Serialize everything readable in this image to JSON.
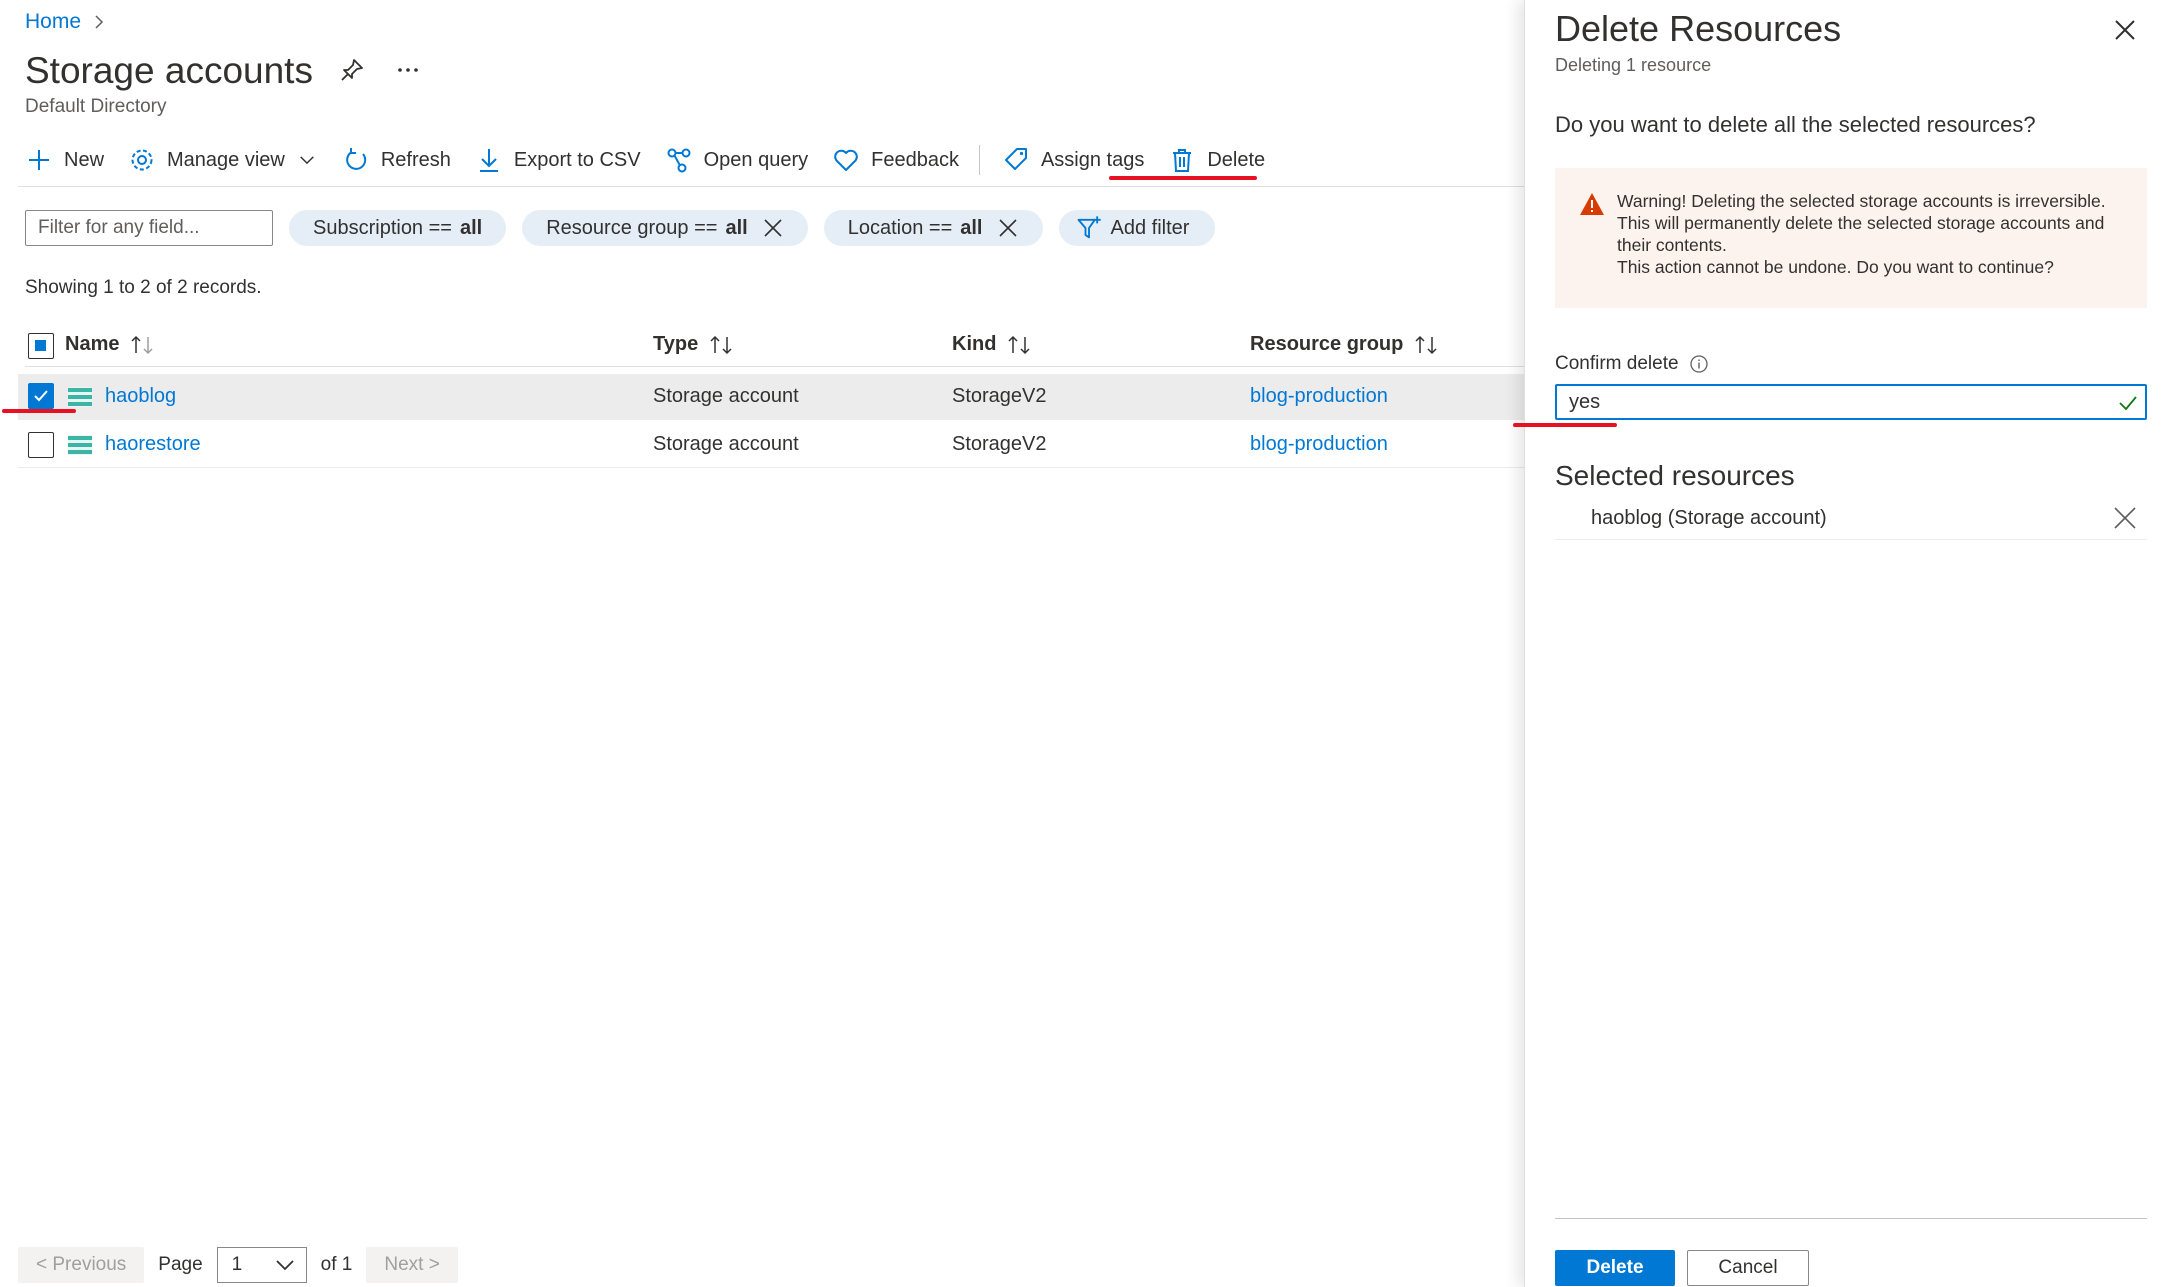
{
  "breadcrumb": {
    "home": "Home"
  },
  "page": {
    "title": "Storage accounts",
    "subtitle": "Default Directory"
  },
  "toolbar": {
    "new": "New",
    "manage_view": "Manage view",
    "refresh": "Refresh",
    "export_csv": "Export to CSV",
    "open_query": "Open query",
    "feedback": "Feedback",
    "assign_tags": "Assign tags",
    "delete": "Delete"
  },
  "filters": {
    "placeholder": "Filter for any field...",
    "subscription": {
      "label": "Subscription ==",
      "value": "all"
    },
    "resource_group": {
      "label": "Resource group ==",
      "value": "all"
    },
    "location": {
      "label": "Location ==",
      "value": "all"
    },
    "add_filter": "Add filter"
  },
  "records_text": "Showing 1 to 2 of 2 records.",
  "columns": {
    "name": "Name",
    "type": "Type",
    "kind": "Kind",
    "resource_group": "Resource group"
  },
  "rows": [
    {
      "name": "haoblog",
      "type": "Storage account",
      "kind": "StorageV2",
      "resource_group": "blog-production",
      "selected": true
    },
    {
      "name": "haorestore",
      "type": "Storage account",
      "kind": "StorageV2",
      "resource_group": "blog-production",
      "selected": false
    }
  ],
  "pager": {
    "previous": "< Previous",
    "page_label": "Page",
    "page_value": "1",
    "of_label": "of 1",
    "next": "Next >"
  },
  "panel": {
    "title": "Delete Resources",
    "subtitle": "Deleting 1 resource",
    "question": "Do you want to delete all the selected resources?",
    "warning_lines": [
      "Warning! Deleting the selected storage accounts is irreversible.",
      "This will permanently delete the selected storage accounts and",
      "their contents.",
      "This action cannot be undone. Do you want to continue?"
    ],
    "confirm_label": "Confirm delete",
    "confirm_value": "yes",
    "selected_heading": "Selected resources",
    "selected_item": "haoblog  (Storage account)",
    "delete_button": "Delete",
    "cancel_button": "Cancel"
  },
  "colors": {
    "accent": "#0078d4",
    "annotation": "#e81123",
    "warning_bg": "#fdf3ee",
    "warning_icon": "#d83b01",
    "storage_icon": "#3bb5a6"
  },
  "icons": [
    "chevron-right-icon",
    "pin-icon",
    "more-icon",
    "plus-icon",
    "gear-icon",
    "chevron-down-icon",
    "refresh-icon",
    "download-icon",
    "query-icon",
    "heart-icon",
    "tag-icon",
    "trash-icon",
    "close-icon",
    "funnel-plus-icon",
    "sort-icon",
    "storage-icon",
    "warning-icon",
    "info-icon",
    "checkmark-icon"
  ]
}
